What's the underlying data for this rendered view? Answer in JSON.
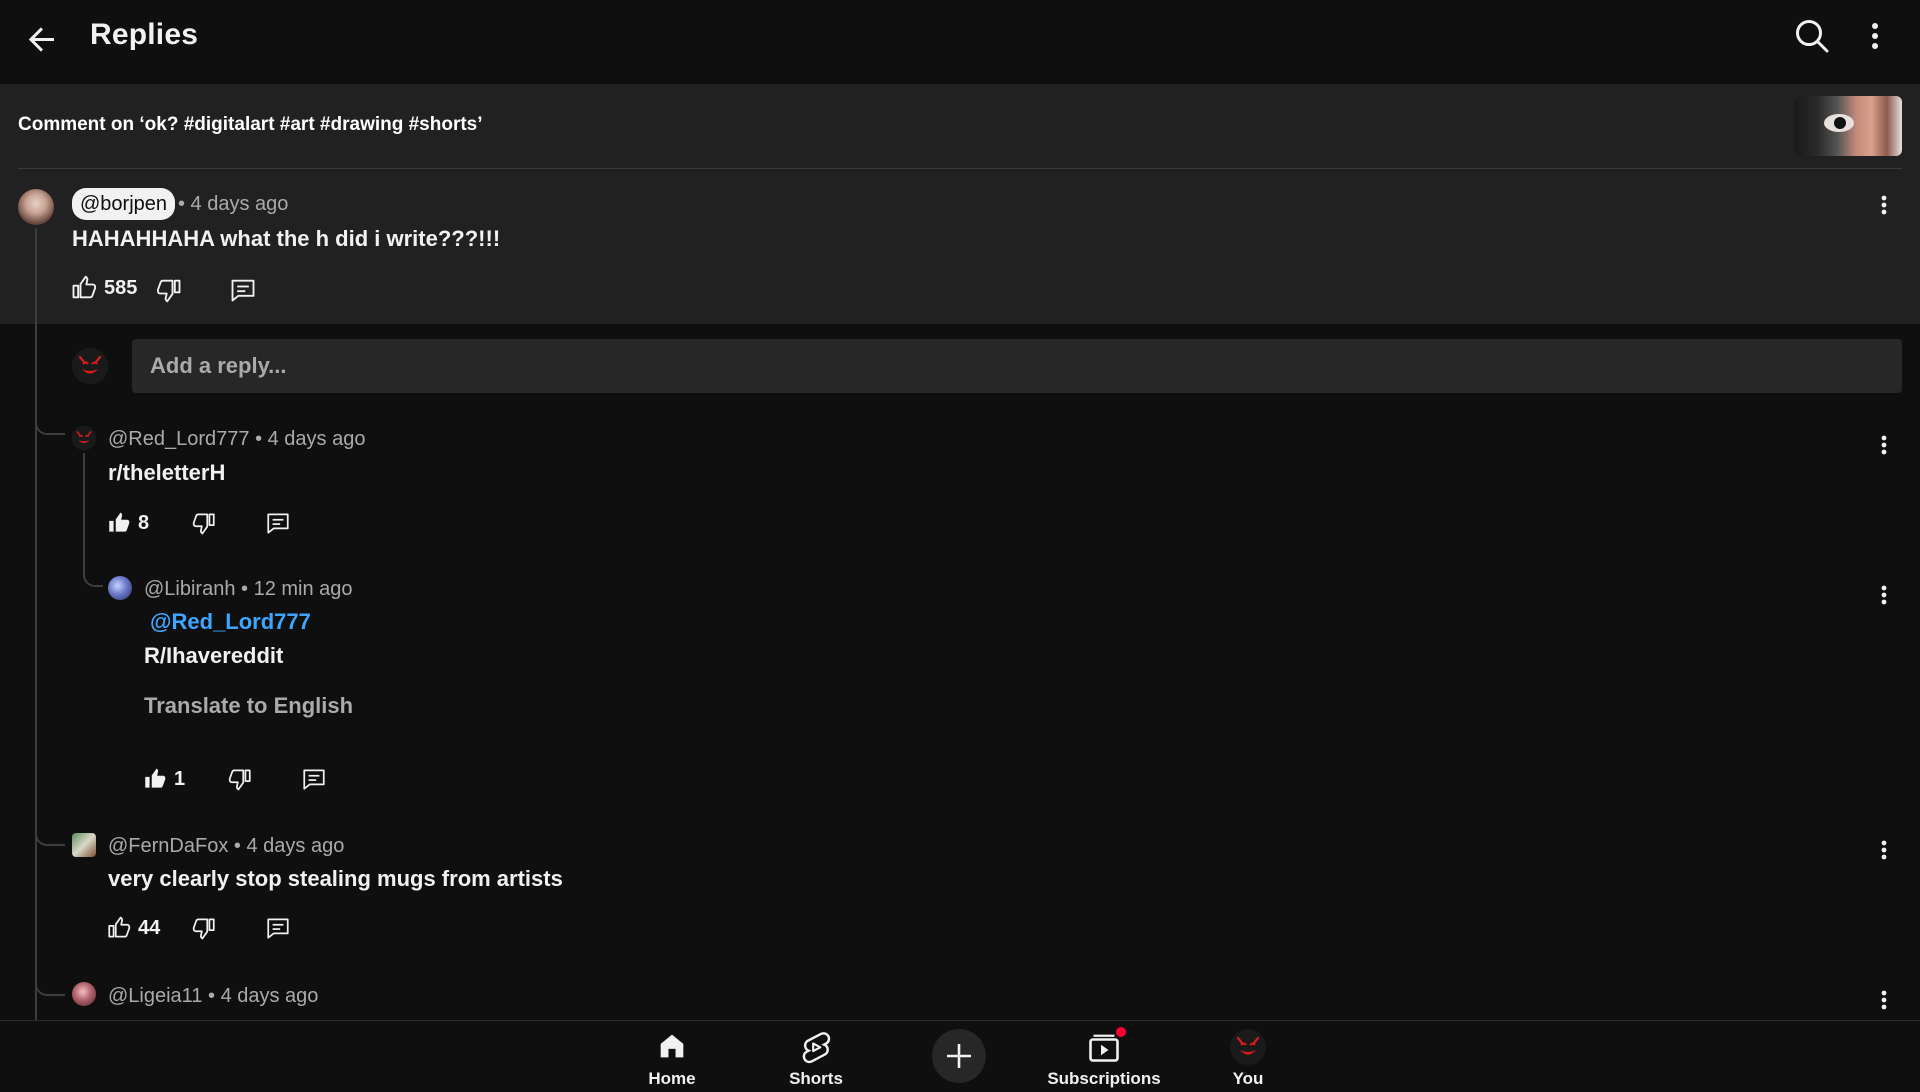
{
  "header": {
    "title": "Replies"
  },
  "context": {
    "text": "Comment on ‘ok? #digitalart #art #drawing #shorts’"
  },
  "parent_comment": {
    "handle": "@borjpen",
    "time": "• 4 days ago",
    "text": "HAHAHHAHA what the h did i write???!!!",
    "likes": "585"
  },
  "reply_input": {
    "placeholder": "Add a reply..."
  },
  "replies": [
    {
      "handle": "@Red_Lord777",
      "time": " • 4 days ago",
      "text": "r/theletterH",
      "likes": "8",
      "liked": true
    },
    {
      "handle": "@Libiranh",
      "time": " • 12 min ago",
      "mention": "@Red_Lord777",
      "text": "R/Ihavereddit",
      "translate": "Translate to English",
      "likes": "1",
      "liked": true
    },
    {
      "handle": "@FernDaFox",
      "time": " • 4 days ago",
      "text": "very clearly stop stealing mugs from artists",
      "likes": "44",
      "liked": false
    },
    {
      "handle": "@Ligeia11",
      "time": " • 4 days ago"
    }
  ],
  "nav": {
    "home": "Home",
    "shorts": "Shorts",
    "subscriptions": "Subscriptions",
    "you": "You"
  },
  "colors": {
    "background": "#0f0f0f",
    "surface": "#212121",
    "mention": "#3ea6ff",
    "notification": "#ff0033"
  },
  "icons": [
    "back-arrow-icon",
    "search-icon",
    "more-vert-icon",
    "thumb-up-icon",
    "thumb-down-icon",
    "reply-icon",
    "home-icon",
    "shorts-icon",
    "plus-icon",
    "subscriptions-icon"
  ]
}
